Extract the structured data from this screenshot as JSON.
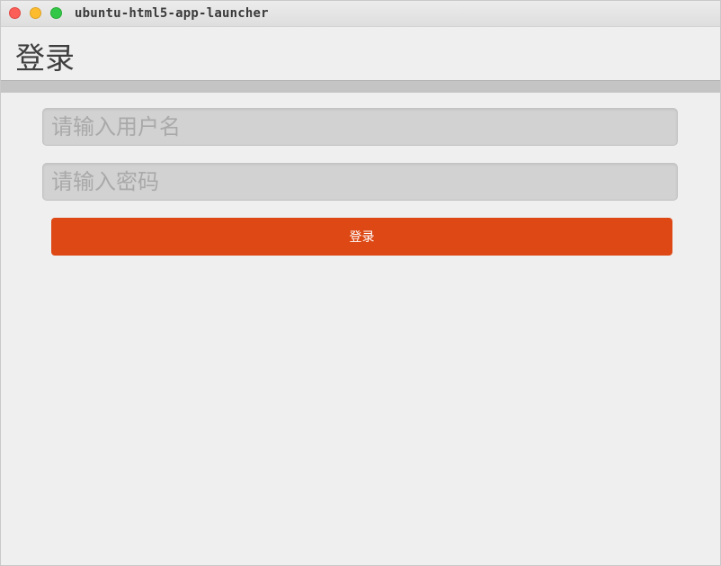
{
  "window": {
    "title": "ubuntu-html5-app-launcher"
  },
  "header": {
    "title": "登录"
  },
  "form": {
    "username_placeholder": "请输入用户名",
    "password_placeholder": "请输入密码",
    "username_value": "",
    "password_value": "",
    "login_label": "登录"
  },
  "colors": {
    "accent": "#dd4814",
    "background": "#efefef",
    "divider": "#c4c4c4",
    "input": "#d2d2d2"
  },
  "icons": {
    "close": "close-button",
    "minimize": "minimize-button",
    "maximize": "maximize-button"
  }
}
